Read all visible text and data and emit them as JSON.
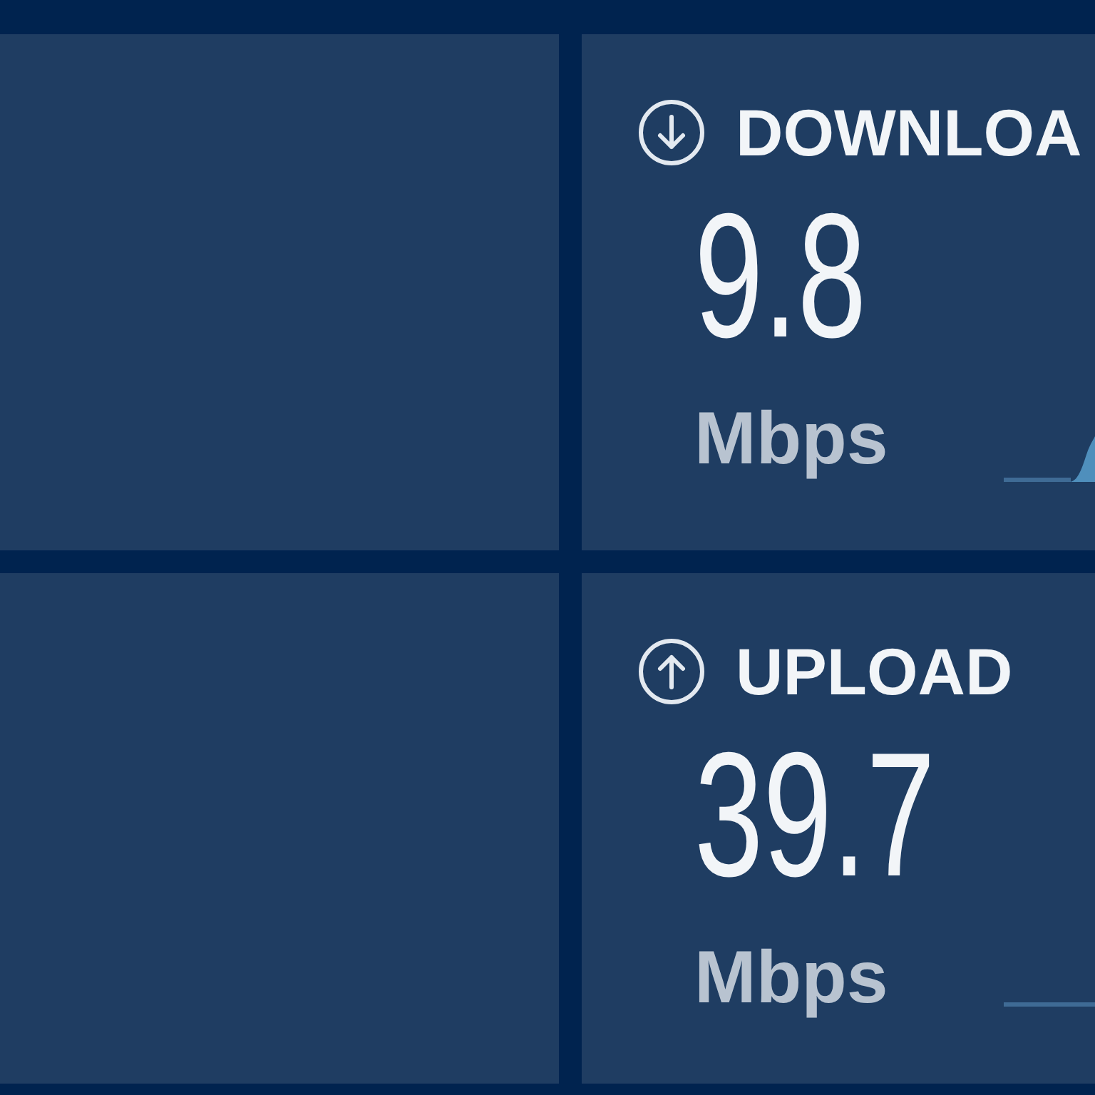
{
  "metrics": [
    {
      "kind": "download",
      "label": "DOWNLOA",
      "value": "9.8",
      "unit": "Mbps"
    },
    {
      "kind": "upload",
      "label": "UPLOAD",
      "value": "39.7",
      "unit": "Mbps"
    }
  ]
}
